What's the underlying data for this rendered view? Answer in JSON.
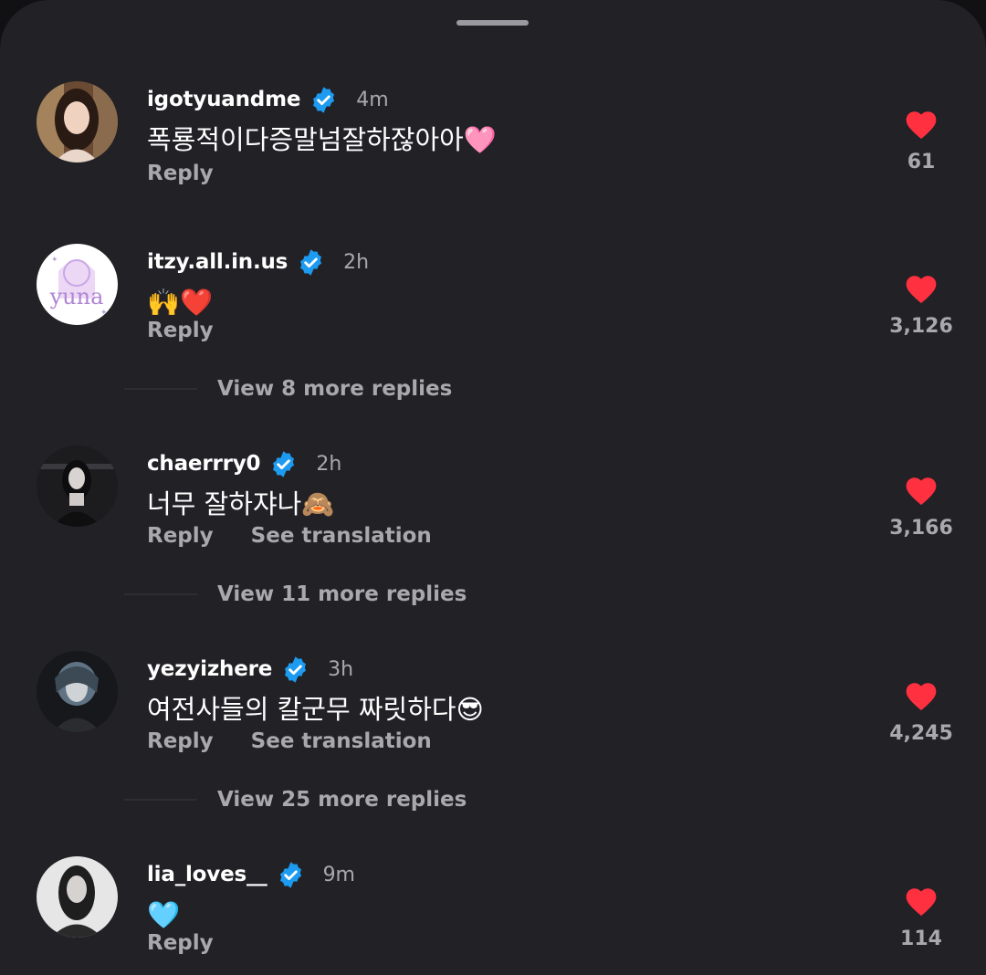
{
  "comments": [
    {
      "username": "igotyuandme",
      "time": "4m",
      "text": "폭룡적이다증말넘잘하잖아아🩷",
      "reply_label": "Reply",
      "likes": "61"
    },
    {
      "username": "itzy.all.in.us",
      "time": "2h",
      "text": "🙌❤️",
      "reply_label": "Reply",
      "likes": "3,126",
      "view_more": "View 8 more replies"
    },
    {
      "username": "chaerrry0",
      "time": "2h",
      "text": "너무 잘하쟈나🙈",
      "reply_label": "Reply",
      "translate_label": "See translation",
      "likes": "3,166",
      "view_more": "View 11 more replies"
    },
    {
      "username": "yezyizhere",
      "time": "3h",
      "text": "여전사들의 칼군무 짜릿하다😎",
      "reply_label": "Reply",
      "translate_label": "See translation",
      "likes": "4,245",
      "view_more": "View 25 more replies"
    },
    {
      "username": "lia_loves__",
      "time": "9m",
      "text": "🩵",
      "reply_label": "Reply",
      "likes": "114"
    }
  ],
  "avatars": {
    "c1_logo_text": "yuna"
  },
  "colors": {
    "background": "#212126",
    "verified": "#1d9bf0",
    "heart": "#ff3040",
    "secondary_text": "#a8a8ad"
  },
  "icons": [
    "verified-badge-icon",
    "heart-icon"
  ]
}
